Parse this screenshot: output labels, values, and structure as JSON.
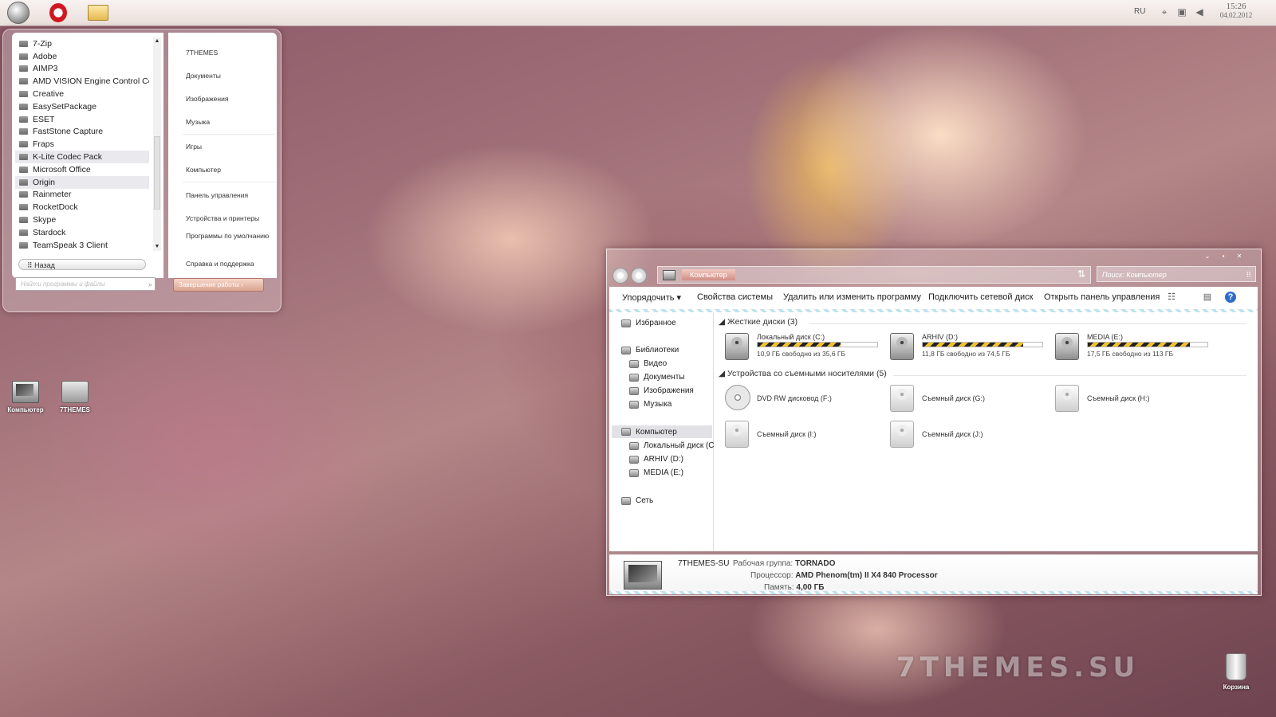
{
  "taskbar": {
    "apps": [
      {
        "name": "start-orb-icon"
      },
      {
        "name": "opera-icon"
      },
      {
        "name": "explorer-folder-icon"
      }
    ],
    "language": "RU",
    "clock_time": "15:26",
    "clock_date": "04.02.2012"
  },
  "start_menu": {
    "programs": [
      {
        "label": "7-Zip",
        "highlighted": false
      },
      {
        "label": "Adobe",
        "highlighted": false
      },
      {
        "label": "AIMP3",
        "highlighted": false
      },
      {
        "label": "AMD VISION Engine Control Center",
        "highlighted": false
      },
      {
        "label": "Creative",
        "highlighted": false
      },
      {
        "label": "EasySetPackage",
        "highlighted": false
      },
      {
        "label": "ESET",
        "highlighted": false
      },
      {
        "label": "FastStone Capture",
        "highlighted": false
      },
      {
        "label": "Fraps",
        "highlighted": false
      },
      {
        "label": "K-Lite Codec Pack",
        "highlighted": true
      },
      {
        "label": "Microsoft Office",
        "highlighted": false
      },
      {
        "label": "Origin",
        "highlighted": true
      },
      {
        "label": "Rainmeter",
        "highlighted": false
      },
      {
        "label": "RocketDock",
        "highlighted": false
      },
      {
        "label": "Skype",
        "highlighted": false
      },
      {
        "label": "Stardock",
        "highlighted": false
      },
      {
        "label": "TeamSpeak 3 Client",
        "highlighted": false
      }
    ],
    "back_label": "Назад",
    "search_placeholder": "Найти программы и файлы",
    "shutdown_label": "Завершение работы",
    "right_links": [
      "7THEMES",
      "Документы",
      "Изображения",
      "Музыка",
      "Игры",
      "Компьютер",
      "Панель управления",
      "Устройства и принтеры",
      "Программы по умолчанию",
      "Справка и поддержка"
    ]
  },
  "desktop": {
    "icons": [
      {
        "label": "Компьютер",
        "icon": "computer-icon"
      },
      {
        "label": "7THEMES",
        "icon": "folder-icon"
      },
      {
        "label": "Корзина",
        "icon": "recycle-bin-icon"
      }
    ],
    "watermark": "7THEMES.SU"
  },
  "explorer": {
    "address": "Компьютер",
    "search_placeholder": "Поиск: Компьютер",
    "toolbar": {
      "organize": "Упорядочить",
      "system_properties": "Свойства системы",
      "uninstall": "Удалить или изменить программу",
      "map_drive": "Подключить сетевой диск",
      "control_panel": "Открыть панель управления"
    },
    "nav": {
      "favorites": "Избранное",
      "libraries": "Библиотеки",
      "video": "Видео",
      "documents": "Документы",
      "pictures": "Изображения",
      "music": "Музыка",
      "computer": "Компьютер",
      "drive_c": "Локальный диск (C:)",
      "drive_d": "ARHIV (D:)",
      "drive_e": "MEDIA (E:)",
      "network": "Сеть"
    },
    "groups": {
      "hard_drives": "Жесткие диски (3)",
      "removable": "Устройства со съемными носителями (5)"
    },
    "hard_drives": [
      {
        "name": "Локальный диск (C:)",
        "free_text": "10,9 ГБ свободно из 35,6 ГБ",
        "used_fraction": 0.69
      },
      {
        "name": "ARHIV (D:)",
        "free_text": "11,8 ГБ свободно из 74,5 ГБ",
        "used_fraction": 0.84
      },
      {
        "name": "MEDIA (E:)",
        "free_text": "17,5 ГБ свободно из 113 ГБ",
        "used_fraction": 0.85
      }
    ],
    "removable": [
      {
        "name": "DVD RW дисковод (F:)",
        "icon": "dvd-drive-icon"
      },
      {
        "name": "Съемный диск (G:)",
        "icon": "removable-disk-icon"
      },
      {
        "name": "Съемный диск (H:)",
        "icon": "removable-disk-icon"
      },
      {
        "name": "Съемный диск (I:)",
        "icon": "removable-disk-icon"
      },
      {
        "name": "Съемный диск (J:)",
        "icon": "removable-disk-icon"
      }
    ],
    "details": {
      "computer_name": "7THEMES-SU",
      "workgroup_label": "Рабочая группа:",
      "workgroup_value": "TORNADO",
      "processor_label": "Процессор:",
      "processor_value": "AMD Phenom(tm) II X4 840 Processor",
      "memory_label": "Память:",
      "memory_value": "4,00 ГБ"
    }
  }
}
